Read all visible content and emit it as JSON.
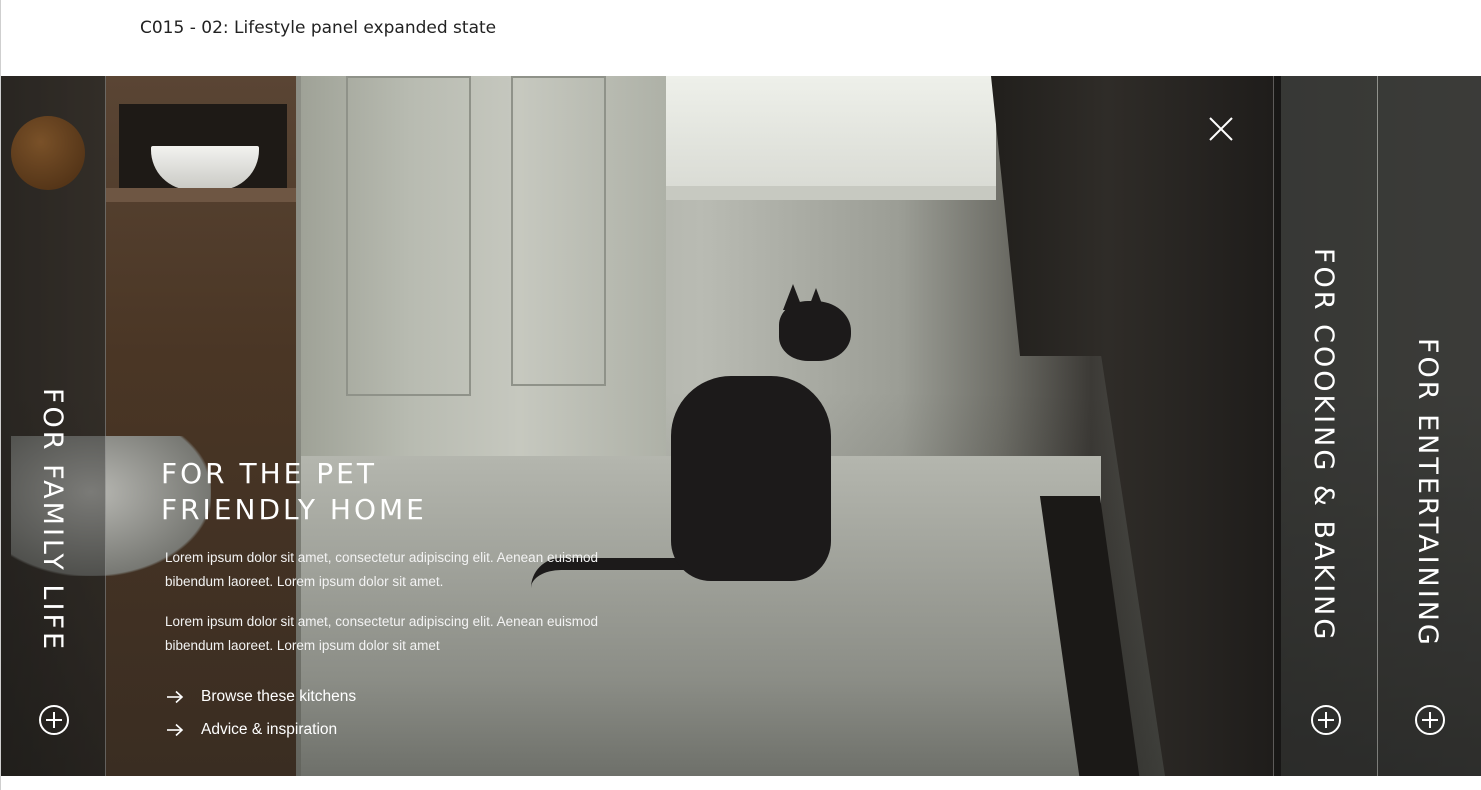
{
  "frame_label": "C015 - 02: Lifestyle panel expanded state",
  "panels": {
    "left": {
      "title": "FOR FAMILY LIFE",
      "icon": "plus-circle-icon"
    },
    "right_1": {
      "title": "FOR COOKING & BAKING",
      "icon": "plus-circle-icon"
    },
    "right_2": {
      "title": "FOR ENTERTAINING",
      "icon": "plus-circle-icon"
    }
  },
  "expanded": {
    "title_line1": "FOR THE PET",
    "title_line2": "FRIENDLY HOME",
    "paragraph1": "Lorem ipsum dolor sit amet, consectetur adipiscing elit. Aenean euismod bibendum laoreet. Lorem ipsum dolor sit amet.",
    "paragraph2": "Lorem ipsum dolor sit amet, consectetur adipiscing elit. Aenean euismod bibendum laoreet. Lorem ipsum dolor sit amet",
    "links": [
      {
        "label": "Browse these kitchens",
        "icon": "arrow-right-icon"
      },
      {
        "label": "Advice & inspiration",
        "icon": "arrow-right-icon"
      }
    ],
    "close_icon": "close-icon"
  }
}
